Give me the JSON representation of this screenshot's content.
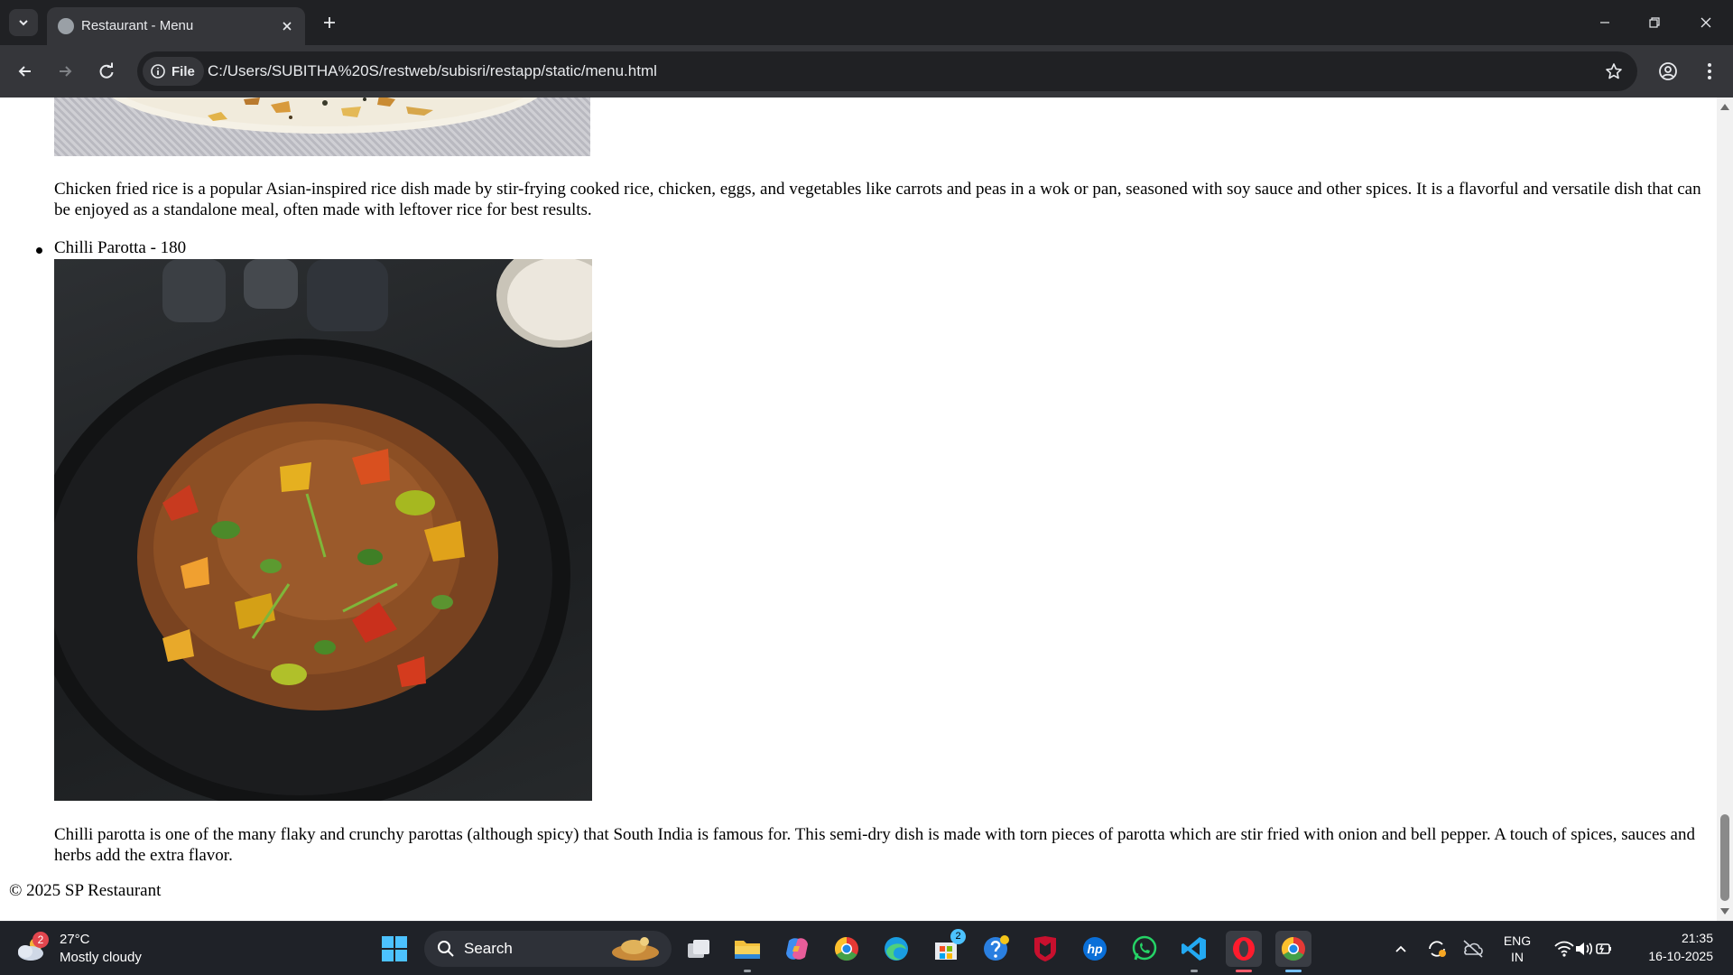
{
  "browser": {
    "tab_title": "Restaurant - Menu",
    "site_chip": "File",
    "url": "C:/Users/SUBITHA%20S/restweb/subisri/restapp/static/menu.html"
  },
  "page": {
    "items": [
      {
        "description": "Chicken fried rice is a popular Asian-inspired rice dish made by stir-frying cooked rice, chicken, eggs, and vegetables like carrots and peas in a wok or pan, seasoned with soy sauce and other spices. It is a flavorful and versatile dish that can be enjoyed as a standalone meal, often made with leftover rice for best results."
      },
      {
        "label": "Chilli Parotta - 180",
        "description": "Chilli parotta is one of the many flaky and crunchy parottas (although spicy) that South India is famous for. This semi-dry dish is made with torn pieces of parotta which are stir fried with onion and bell pepper. A touch of spices, sauces and herbs add the extra flavor."
      }
    ],
    "footer": "© 2025 SP Restaurant"
  },
  "taskbar": {
    "weather_temp": "27°C",
    "weather_desc": "Mostly cloudy",
    "weather_badge": "2",
    "search_label": "Search",
    "store_badge": "2",
    "lang_top": "ENG",
    "lang_bottom": "IN",
    "time": "21:35",
    "date": "16-10-2025"
  },
  "colors": {
    "chrome_dark": "#202124",
    "chrome_toolbar": "#35363a",
    "taskbar": "#1f2228",
    "accent": "#75c0ff"
  }
}
